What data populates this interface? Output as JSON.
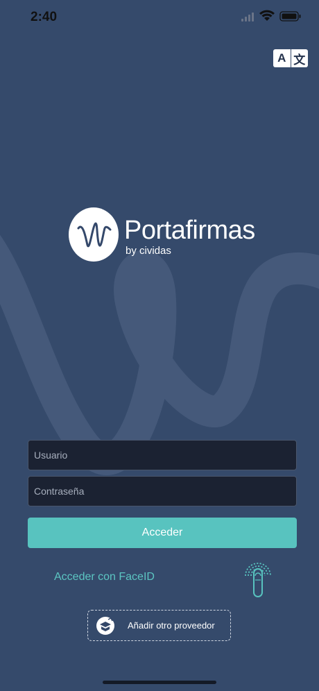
{
  "status_bar": {
    "time": "2:40",
    "icons": [
      "signal-icon",
      "wifi-icon",
      "battery-icon"
    ]
  },
  "translate_button": {
    "icon": "translate-icon",
    "glyph_latin": "A",
    "glyph_cjk": "文"
  },
  "brand": {
    "title": "Portafirmas",
    "subtitle": "by cividas",
    "logo_icon": "signature-logo-icon"
  },
  "login_form": {
    "username_placeholder": "Usuario",
    "username_value": "",
    "password_placeholder": "Contraseña",
    "password_value": "",
    "submit_label": "Acceder"
  },
  "faceid": {
    "link_label": "Acceder con FaceID",
    "icon": "fingerprint-icon"
  },
  "provider": {
    "label": "Añadir otro proveedor",
    "icon": "provider-badge-icon"
  },
  "colors": {
    "background": "#354a6b",
    "accent": "#58c3bf",
    "field_background": "#1b2232",
    "text_light": "#ffffff"
  }
}
